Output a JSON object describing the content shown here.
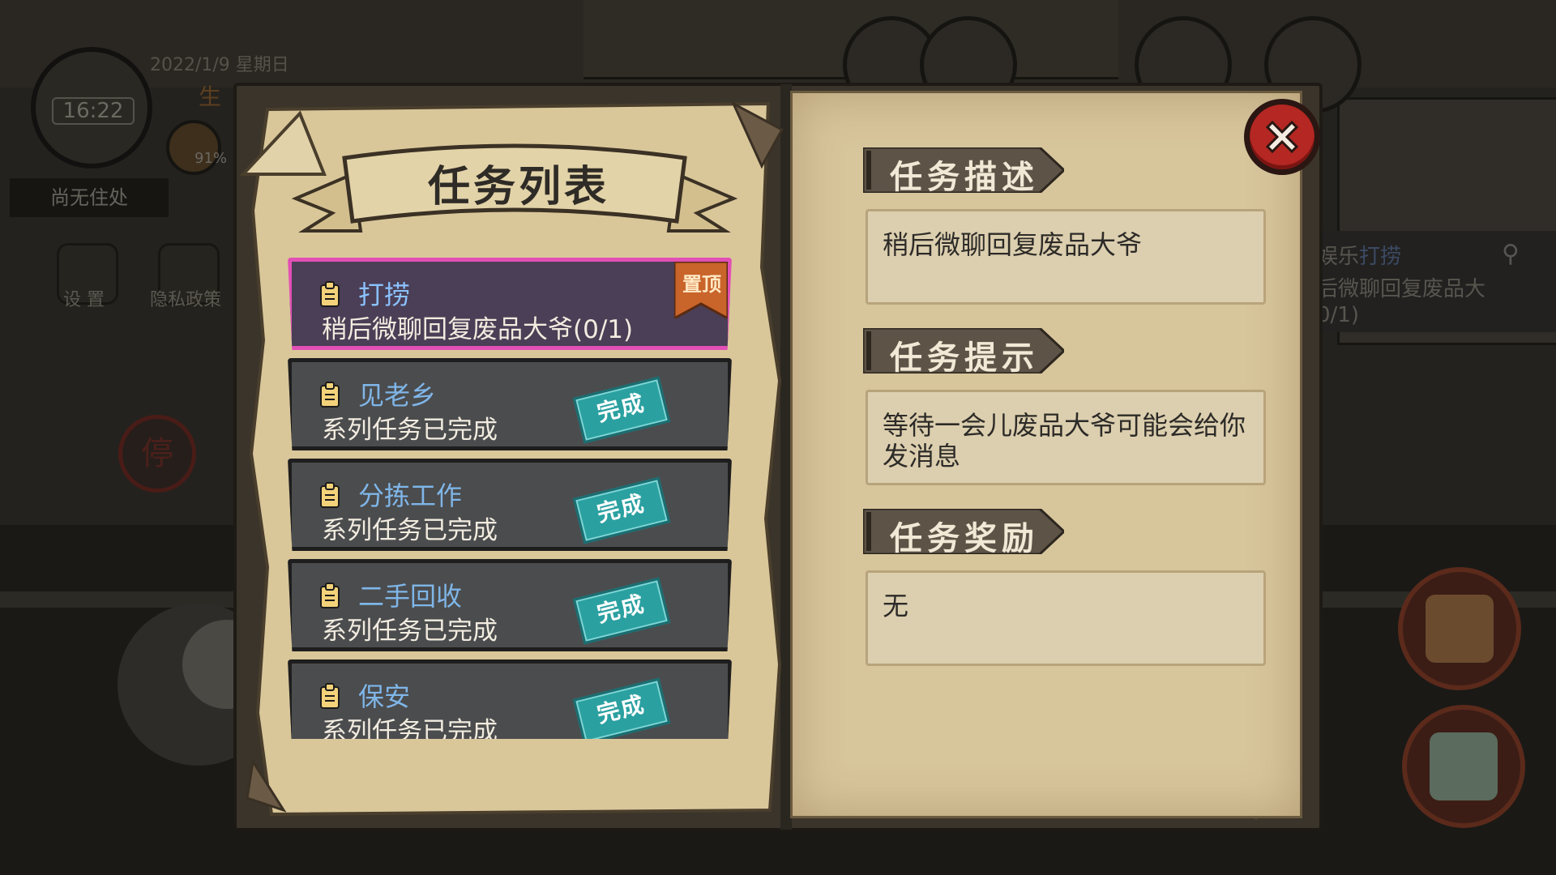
{
  "hud": {
    "time": "16:22",
    "date": "2022/1/9 星期日",
    "life_label": "生",
    "stamina": "91%",
    "residence": "尚无住处",
    "settings_label": "设 置",
    "privacy_label": "隐私政策",
    "stop_sign": "停"
  },
  "quest_tracker": {
    "line1_prefix": "娱乐",
    "line1_task": "打捞",
    "line2": "后微聊回复废品大",
    "line3": "0/1)"
  },
  "task_panel": {
    "list_title": "任务列表",
    "tasks": [
      {
        "name": "打捞",
        "subtitle": "稍后微聊回复废品大爷(0/1)",
        "badge": "置顶",
        "status": "active"
      },
      {
        "name": "见老乡",
        "subtitle": "系列任务已完成",
        "badge": "完成",
        "status": "complete"
      },
      {
        "name": "分拣工作",
        "subtitle": "系列任务已完成",
        "badge": "完成",
        "status": "complete"
      },
      {
        "name": "二手回收",
        "subtitle": "系列任务已完成",
        "badge": "完成",
        "status": "complete"
      },
      {
        "name": "保安",
        "subtitle": "系列任务已完成",
        "badge": "完成",
        "status": "complete"
      }
    ]
  },
  "details": {
    "description_title": "任务描述",
    "description": "稍后微聊回复废品大爷",
    "hint_title": "任务提示",
    "hint": "等待一会儿废品大爷可能会给你发消息",
    "reward_title": "任务奖励",
    "reward": "无"
  },
  "colors": {
    "active_border": "#e24fb5",
    "task_name": "#7fb6e8",
    "done_stamp": "#2ba0a0",
    "close_button": "#b42722",
    "parchment": "#d7c59c"
  }
}
